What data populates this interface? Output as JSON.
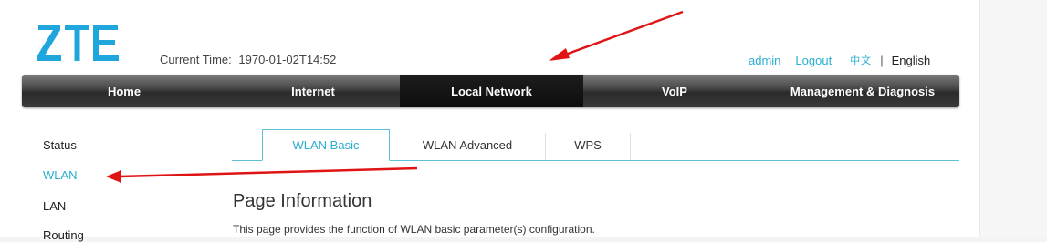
{
  "header": {
    "logo_text": "ZTE",
    "current_time_label": "Current Time:",
    "current_time_value": "1970-01-02T14:52",
    "user": "admin",
    "logout": "Logout",
    "lang_cn": "中文",
    "lang_separator": "|",
    "lang_en": "English"
  },
  "nav": {
    "items": [
      {
        "label": "Home"
      },
      {
        "label": "Internet"
      },
      {
        "label": "Local Network"
      },
      {
        "label": "VoIP"
      },
      {
        "label": "Management & Diagnosis"
      }
    ],
    "active_item": "Local Network"
  },
  "sidebar": {
    "items": [
      {
        "label": "Status"
      },
      {
        "label": "WLAN"
      },
      {
        "label": "LAN"
      },
      {
        "label": "Routing"
      }
    ],
    "active_item": "WLAN"
  },
  "tabs": {
    "items": [
      {
        "label": "WLAN Basic"
      },
      {
        "label": "WLAN Advanced"
      },
      {
        "label": "WPS"
      }
    ],
    "active_item": "WLAN Basic"
  },
  "content": {
    "title": "Page Information",
    "description": "This page provides the function of WLAN basic parameter(s) configuration."
  },
  "colors": {
    "accent": "#2aaed1",
    "logo": "#1fa6dc",
    "annotation_arrow": "#e01414"
  }
}
